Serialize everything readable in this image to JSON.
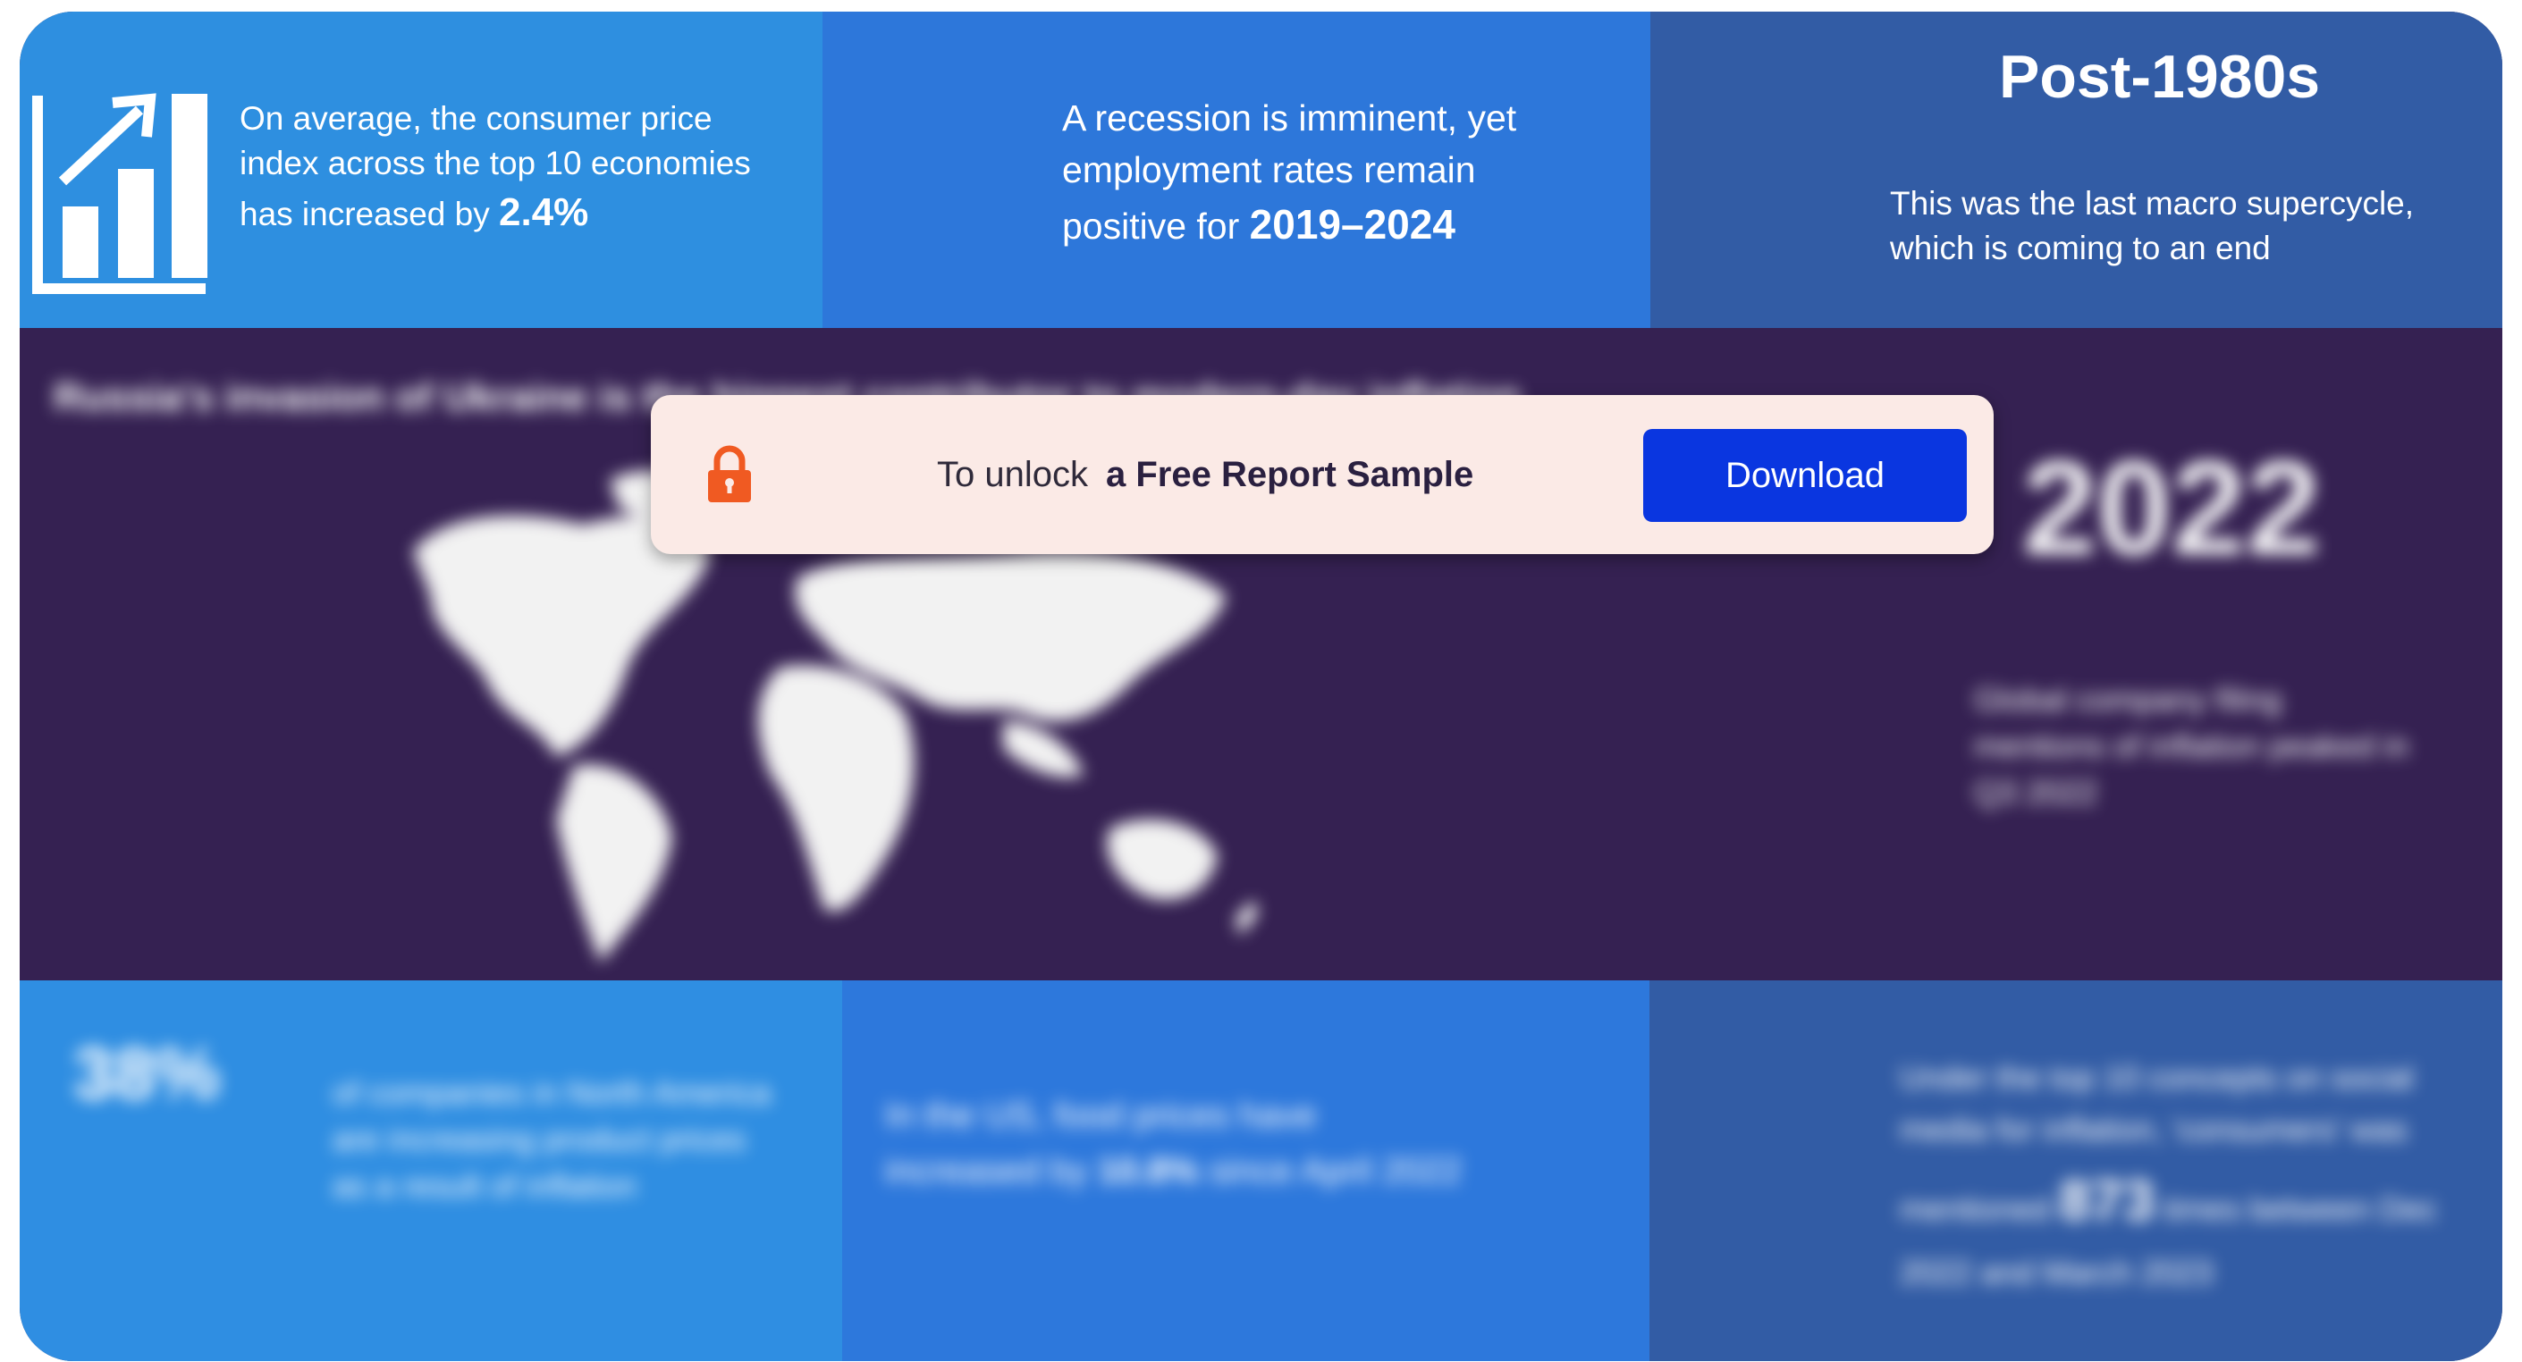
{
  "top": {
    "tile1": {
      "text": "On average, the consumer price index across the top 10 economies has increased by",
      "value": "2.4%"
    },
    "tile2": {
      "text": "A recession is imminent, yet employment rates remain positive for",
      "value": "2019–2024"
    },
    "tile3": {
      "title": "Post-1980s",
      "text": "This was the last macro supercycle, which is coming to an end"
    }
  },
  "middle": {
    "heading": "Russia's invasion of Ukraine is the biggest contributor to modern-day inflation",
    "year": "2022",
    "note": "Global company filing mentions of inflation peaked in Q3 2022"
  },
  "bottom": {
    "tile1": {
      "value": "38%",
      "text": "of companies in North America are increasing product prices as a result of inflation"
    },
    "tile2": {
      "text_before": "In the US, food prices have increased by",
      "value": "10.8%",
      "text_after": "since April 2022"
    },
    "tile3": {
      "text_before": "Under the top 10 concepts on social media for inflation, 'consumers' was mentioned",
      "value": "873",
      "text_after": "times between Dec 2022 and March 2023"
    }
  },
  "unlock_bar": {
    "prefix": "To unlock",
    "strong": "a Free Report Sample",
    "button_label": "Download"
  },
  "colors": {
    "lock_icon": "#f05a22",
    "button": "#0a36e0",
    "bar_bg": "#fbeae6"
  }
}
